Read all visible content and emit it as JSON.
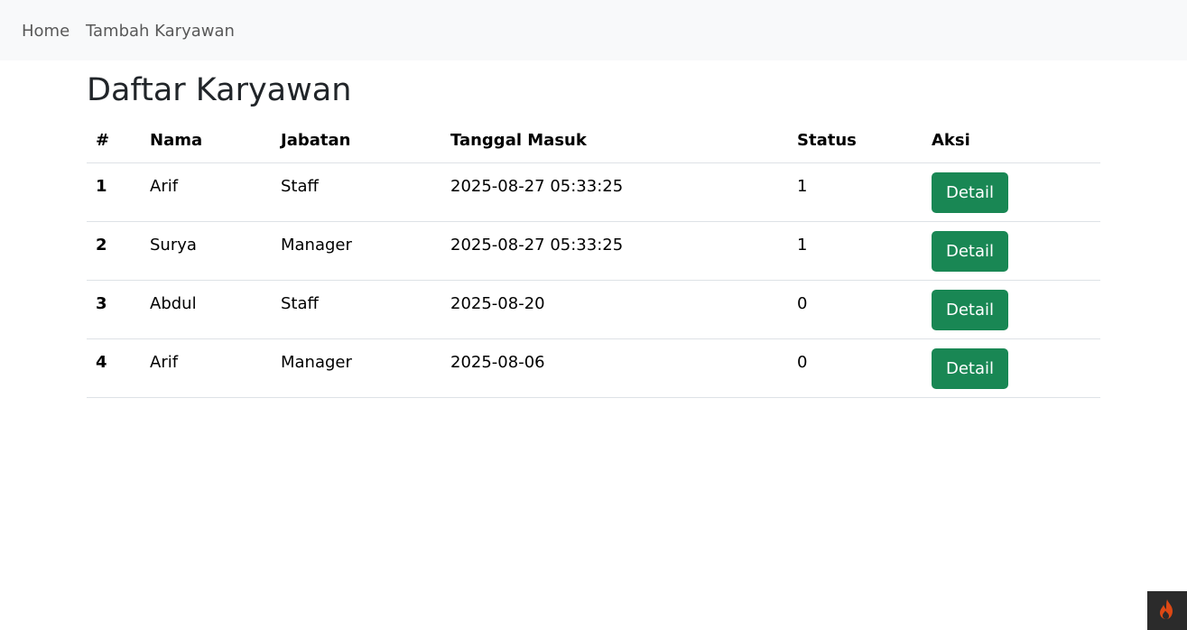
{
  "nav": {
    "home_label": "Home",
    "add_employee_label": "Tambah Karyawan"
  },
  "page": {
    "title": "Daftar Karyawan"
  },
  "table": {
    "headers": [
      "#",
      "Nama",
      "Jabatan",
      "Tanggal Masuk",
      "Status",
      "Aksi"
    ],
    "rows": [
      {
        "no": "1",
        "nama": "Arif",
        "jabatan": "Staff",
        "tanggal": "2025-08-27 05:33:25",
        "status": "1",
        "action": "Detail"
      },
      {
        "no": "2",
        "nama": "Surya",
        "jabatan": "Manager",
        "tanggal": "2025-08-27 05:33:25",
        "status": "1",
        "action": "Detail"
      },
      {
        "no": "3",
        "nama": "Abdul",
        "jabatan": "Staff",
        "tanggal": "2025-08-20",
        "status": "0",
        "action": "Detail"
      },
      {
        "no": "4",
        "nama": "Arif",
        "jabatan": "Manager",
        "tanggal": "2025-08-06",
        "status": "0",
        "action": "Detail"
      }
    ]
  },
  "colors": {
    "navbar_bg": "#f8f9fa",
    "button_bg": "#198754",
    "debug_toolbar_bg": "#2b2b2b",
    "flame": "#dd4814"
  },
  "icons": {
    "debug_toolbar": "flame-icon"
  }
}
